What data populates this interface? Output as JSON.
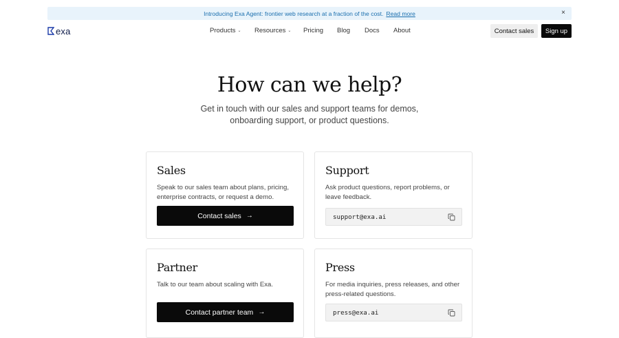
{
  "announcement": {
    "text": "Introducing Exa Agent: frontier web research at a fraction of the cost.",
    "link": "Read more",
    "close": "×"
  },
  "brand": {
    "name": "exa"
  },
  "nav": {
    "items": [
      {
        "label": "Products",
        "dropdown": true
      },
      {
        "label": "Resources",
        "dropdown": true
      },
      {
        "label": "Pricing",
        "dropdown": false
      },
      {
        "label": "Blog",
        "dropdown": false
      },
      {
        "label": "Docs",
        "dropdown": false
      },
      {
        "label": "About",
        "dropdown": false
      }
    ],
    "chevron": "⌄",
    "contact_sales": "Contact sales",
    "sign_up": "Sign up"
  },
  "hero": {
    "title": "How can we help?",
    "subtitle": "Get in touch with our sales and support teams for demos, onboarding support, or product questions."
  },
  "cards": {
    "sales": {
      "title": "Sales",
      "description": "Speak to our sales team about plans, pricing, enterprise contracts, or request a demo.",
      "button": "Contact sales"
    },
    "support": {
      "title": "Support",
      "description": "Ask product questions, report problems, or leave feedback.",
      "email": "support@exa.ai"
    },
    "partner": {
      "title": "Partner",
      "description": "Talk to our team about scaling with Exa.",
      "button": "Contact partner team"
    },
    "press": {
      "title": "Press",
      "description": "For media inquiries, press releases, and other press-related questions.",
      "email": "press@exa.ai"
    }
  },
  "icons": {
    "arrow": "→",
    "copy": "copy-icon",
    "logo": "exa-logo-icon"
  },
  "colors": {
    "accent_link": "#1b6fae",
    "banner_bg": "#e8f3fb",
    "button_dark": "#0a0a0a",
    "logo": "#0d1b4a"
  }
}
